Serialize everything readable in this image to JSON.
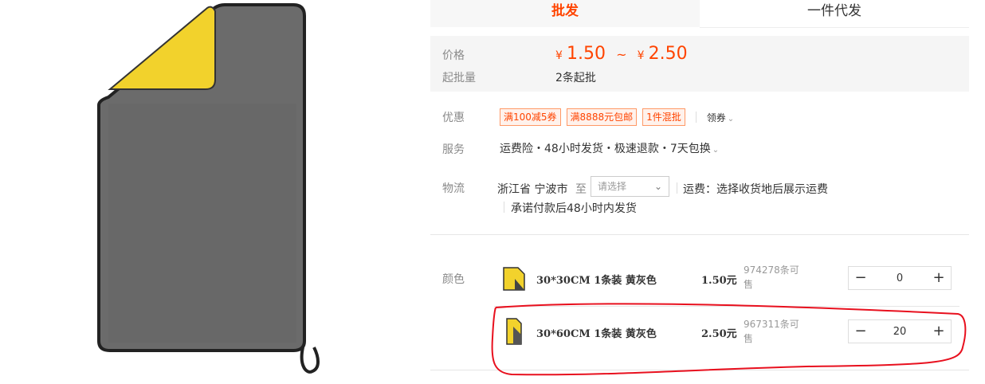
{
  "tabs": [
    {
      "label": "批发"
    },
    {
      "label": "一件代发"
    }
  ],
  "price_panel": {
    "price_label": "价格",
    "currency": "¥",
    "price_min": "1.50",
    "price_tilde": "~",
    "price_max": "2.50",
    "moq_label": "起批量",
    "moq_value": "2条起批"
  },
  "promo": {
    "label": "优惠",
    "coupons": [
      "满100减5券",
      "满8888元包邮",
      "1件混批"
    ],
    "get_coupon": "领券"
  },
  "service": {
    "label": "服务",
    "text": "运费险・48小时发货・极速退款・7天包换"
  },
  "logistics": {
    "label": "物流",
    "from": "浙江省 宁波市",
    "to_label": "至",
    "select_placeholder": "请选择",
    "freight_text": "运费：选择收货地后展示运费",
    "promise": "承诺付款后48小时内发货"
  },
  "color": {
    "label": "颜色",
    "skus": [
      {
        "name": "30*30CM 1条装 黄灰色",
        "price": "1.50元",
        "stock": "974278条可售",
        "qty": "0"
      },
      {
        "name": "30*60CM 1条装 黄灰色",
        "price": "2.50元",
        "stock": "967311条可售",
        "qty": "20"
      }
    ]
  },
  "stepper": {
    "minus": "−",
    "plus": "+"
  },
  "icons": {
    "dropdown": "chevron-down-icon"
  },
  "colors": {
    "accent": "#ff4400",
    "annotation": "#e8101e",
    "towel_gray": "#696969",
    "towel_yellow": "#f2d22c"
  }
}
